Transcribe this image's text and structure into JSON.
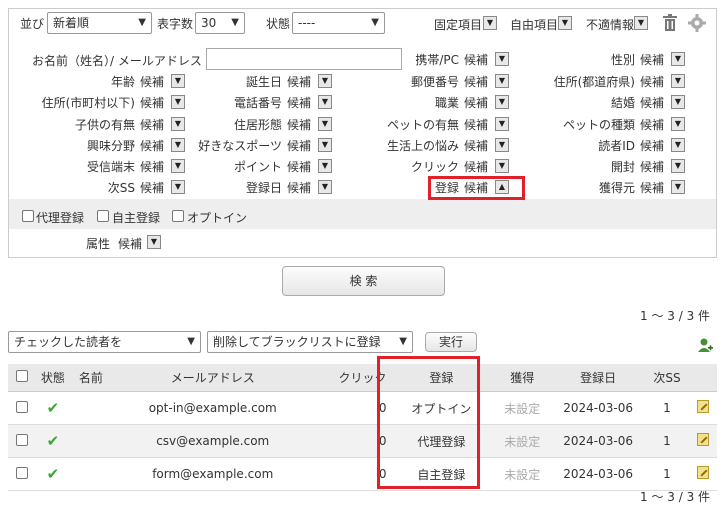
{
  "filter": {
    "sort_label": "並び",
    "sort_value": "新着順",
    "count_label": "表字数",
    "count_value": "30",
    "status_label": "状態",
    "status_value": "----",
    "fixed_label": "固定項目",
    "free_label": "自由項目",
    "invalid_label": "不適情報",
    "name_label": "お名前（姓名）",
    "email_label": "/ メールアドレス",
    "email_value": "",
    "fields": [
      {
        "label": "携帯/PC",
        "value": "候補"
      },
      {
        "label": "性別",
        "value": "候補"
      },
      {
        "label": "年齢",
        "value": "候補"
      },
      {
        "label": "誕生日",
        "value": "候補"
      },
      {
        "label": "郵便番号",
        "value": "候補"
      },
      {
        "label": "住所(都道府県)",
        "value": "候補"
      },
      {
        "label": "住所(市町村以下)",
        "value": "候補"
      },
      {
        "label": "電話番号",
        "value": "候補"
      },
      {
        "label": "職業",
        "value": "候補"
      },
      {
        "label": "結婚",
        "value": "候補"
      },
      {
        "label": "子供の有無",
        "value": "候補"
      },
      {
        "label": "住居形態",
        "value": "候補"
      },
      {
        "label": "ペットの有無",
        "value": "候補"
      },
      {
        "label": "ペットの種類",
        "value": "候補"
      },
      {
        "label": "興味分野",
        "value": "候補"
      },
      {
        "label": "好きなスポーツ",
        "value": "候補"
      },
      {
        "label": "生活上の悩み",
        "value": "候補"
      },
      {
        "label": "読者ID",
        "value": "候補"
      },
      {
        "label": "受信端末",
        "value": "候補"
      },
      {
        "label": "ポイント",
        "value": "候補"
      },
      {
        "label": "クリック",
        "value": "候補"
      },
      {
        "label": "開封",
        "value": "候補"
      },
      {
        "label": "次SS",
        "value": "候補"
      },
      {
        "label": "登録日",
        "value": "候補"
      },
      {
        "label": "登録",
        "value": "候補"
      },
      {
        "label": "獲得元",
        "value": "候補"
      }
    ],
    "options": [
      "代理登録",
      "自主登録",
      "オプトイン"
    ],
    "attr_label": "属性",
    "attr_value": "候補",
    "search_button": "検 索"
  },
  "result_count": "1 〜 3 / 3 件",
  "bulk": {
    "target_value": "チェックした読者を",
    "action_value": "削除してブラックリストに登録",
    "run_button": "実行"
  },
  "table": {
    "headers": [
      "状態",
      "名前",
      "メールアドレス",
      "クリック",
      "登録",
      "獲得",
      "登録日",
      "次SS"
    ],
    "rows": [
      {
        "email": "opt-in@example.com",
        "click": "0",
        "reg": "オプトイン",
        "source": "未設定",
        "date": "2024-03-06",
        "next": "1"
      },
      {
        "email": "csv@example.com",
        "click": "0",
        "reg": "代理登録",
        "source": "未設定",
        "date": "2024-03-06",
        "next": "1"
      },
      {
        "email": "form@example.com",
        "click": "0",
        "reg": "自主登録",
        "source": "未設定",
        "date": "2024-03-06",
        "next": "1"
      }
    ]
  },
  "colors": {
    "highlight": "#e0202a",
    "ok": "#3aa638"
  }
}
